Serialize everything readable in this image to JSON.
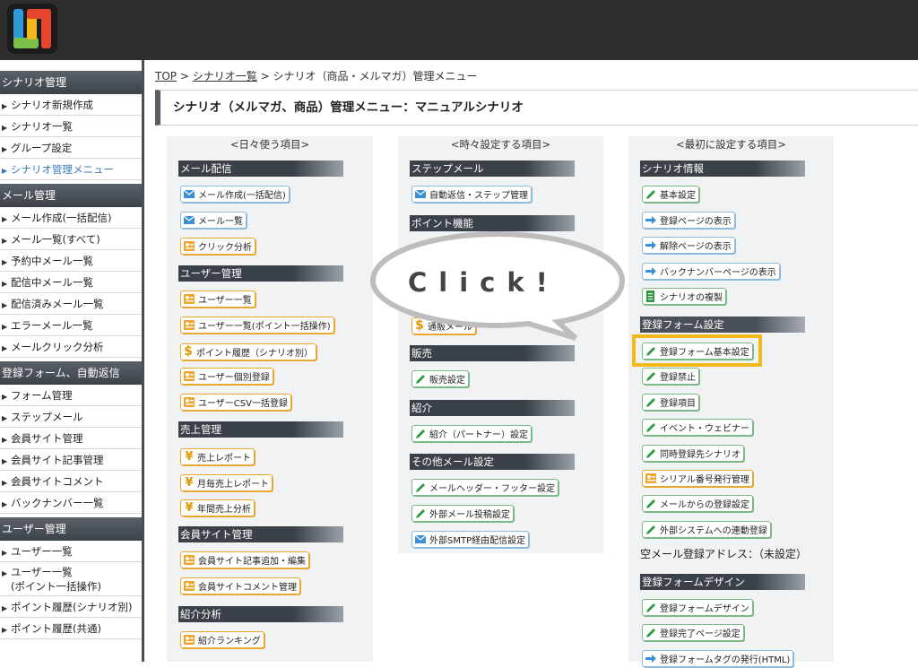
{
  "sidebar": {
    "sections": [
      {
        "title": "シナリオ管理",
        "items": [
          "シナリオ新規作成",
          "シナリオ一覧",
          "グループ設定",
          "シナリオ管理メニュー"
        ]
      },
      {
        "title": "メール管理",
        "items": [
          "メール作成(一括配信)",
          "メール一覧(すべて)",
          "予約中メール一覧",
          "配信中メール一覧",
          "配信済みメール一覧",
          "エラーメール一覧",
          "メールクリック分析"
        ]
      },
      {
        "title": "登録フォーム、自動返信",
        "items": [
          "フォーム管理",
          "ステップメール",
          "会員サイト管理",
          "会員サイト記事管理",
          "会員サイトコメント",
          "バックナンバー一覧"
        ]
      },
      {
        "title": "ユーザー管理",
        "items": [
          "ユーザー一覧",
          "ユーザー一覧",
          "(ポイント一括操作)",
          "ポイント履歴(シナリオ別)",
          "ポイント履歴(共通)"
        ]
      }
    ]
  },
  "breadcrumb": {
    "top": "TOP",
    "sep": ">",
    "list": "シナリオ一覧",
    "current": "シナリオ（商品・メルマガ）管理メニュー"
  },
  "page_title": "シナリオ（メルマガ、商品）管理メニュー：マニュアルシナリオ",
  "columns": {
    "daily": {
      "header": "<日々使う項目>",
      "cat_mail": "メール配信",
      "mail_create": "メール作成(一括配信)",
      "mail_list": "メール一覧",
      "click_analysis": "クリック分析",
      "cat_user": "ユーザー管理",
      "user_list": "ユーザー一覧",
      "user_list_point": "ユーザー一覧(ポイント一括操作)",
      "point_history": "ポイント履歴（シナリオ別）",
      "user_register": "ユーザー個別登録",
      "user_csv": "ユーザーCSV一括登録",
      "cat_sales": "売上管理",
      "sales_report": "売上レポート",
      "monthly_sales": "月毎売上レポート",
      "annual_sales": "年間売上分析",
      "cat_member": "会員サイト管理",
      "member_article": "会員サイト記事追加・編集",
      "member_comment": "会員サイトコメント管理",
      "cat_referral": "紹介分析",
      "referral_ranking": "紹介ランキング"
    },
    "sometimes": {
      "header": "<時々設定する項目>",
      "cat_step": "ステップメール",
      "auto_reply": "自動返信・ステップ管理",
      "cat_point": "ポイント機能",
      "trade_mail": "通販メール",
      "cat_sales": "販売",
      "sales_setting": "販売設定",
      "cat_referral": "紹介",
      "partner_setting": "紹介（パートナー）設定",
      "cat_other": "その他メール設定",
      "header_footer": "メールヘッダー・フッター設定",
      "external_post": "外部メール投稿設定",
      "smtp": "外部SMTP経由配信設定"
    },
    "first": {
      "header": "<最初に設定する項目>",
      "cat_scenario": "シナリオ情報",
      "basic": "基本設定",
      "reg_page": "登録ページの表示",
      "cancel_page": "解除ページの表示",
      "backnumber_page": "バックナンバーページの表示",
      "duplicate": "シナリオの複製",
      "cat_form": "登録フォーム設定",
      "form_basic": "登録フォーム基本設定",
      "reg_ban": "登録禁止",
      "reg_items": "登録項目",
      "event": "イベント・ウェビナー",
      "simul": "同時登録先シナリオ",
      "serial": "シリアル番号発行管理",
      "mail_reg": "メールからの登録設定",
      "external_link": "外部システムへの連動登録",
      "empty_mail": "空メール登録アドレス：（未設定）",
      "cat_design": "登録フォームデザイン",
      "form_design": "登録フォームデザイン",
      "complete_page": "登録完了ページ設定",
      "form_tag": "登録フォームタグの発行(HTML)"
    }
  },
  "overlay": {
    "click_text": "Click!"
  },
  "colors": {
    "highlight": "#f3b81a",
    "topbar": "#2e2e2e",
    "category": "#3b4148"
  },
  "icons": [
    "mail-icon",
    "pencil-icon",
    "arrow-icon",
    "person-card-icon",
    "yen-icon",
    "dollar-icon",
    "document-icon"
  ]
}
